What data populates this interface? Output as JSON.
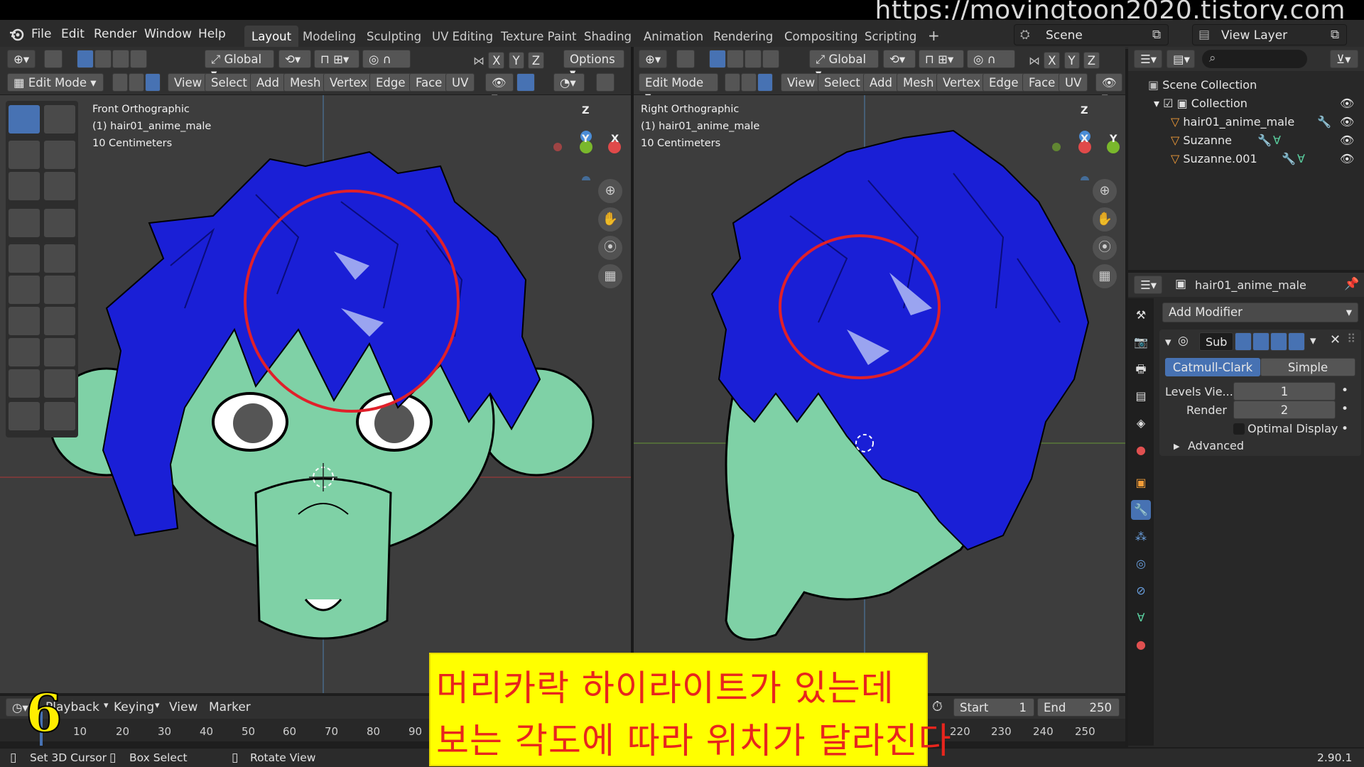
{
  "watermark": "https://movingtoon2020.tistory.com",
  "menu": [
    "File",
    "Edit",
    "Render",
    "Window",
    "Help"
  ],
  "workspaces": [
    "Layout",
    "Modeling",
    "Sculpting",
    "UV Editing",
    "Texture Paint",
    "Shading",
    "Animation",
    "Rendering",
    "Compositing",
    "Scripting"
  ],
  "active_workspace": "Layout",
  "add_tab": "+",
  "scene": {
    "label": "Scene",
    "view_layer": "View Layer"
  },
  "toolbar": {
    "orientation": "Global",
    "axes": [
      "X",
      "Y",
      "Z"
    ],
    "options": "Options",
    "mode": "Edit Mode",
    "menus": [
      "View",
      "Select",
      "Add",
      "Mesh",
      "Vertex",
      "Edge",
      "Face",
      "UV"
    ]
  },
  "viewport_left": {
    "view_name": "Front Orthographic",
    "object": "(1) hair01_anime_male",
    "scale": "10 Centimeters"
  },
  "viewport_right": {
    "view_name": "Right Orthographic",
    "object": "(1) hair01_anime_male",
    "scale": "10 Centimeters"
  },
  "gizmo": {
    "z": "Z",
    "y": "Y",
    "x": "X"
  },
  "outliner": {
    "root": "Scene Collection",
    "collection": "Collection",
    "items": [
      "hair01_anime_male",
      "Suzanne",
      "Suzanne.001"
    ]
  },
  "properties": {
    "object_name": "hair01_anime_male",
    "add_modifier": "Add Modifier",
    "modifier_name": "Sub",
    "subdiv_types": [
      "Catmull-Clark",
      "Simple"
    ],
    "levels_label": "Levels Vie...",
    "levels_value": "1",
    "render_label": "Render",
    "render_value": "2",
    "optimal_display": "Optimal Display",
    "advanced": "Advanced"
  },
  "timeline": {
    "frame_badge": "6",
    "playback": "Playback",
    "keying": "Keying",
    "view": "View",
    "marker": "Marker",
    "ticks_left": [
      "10",
      "20",
      "30",
      "40",
      "50",
      "60",
      "70",
      "80",
      "90"
    ],
    "ticks_right": [
      "220",
      "230",
      "240",
      "250"
    ],
    "start_label": "Start",
    "start_value": "1",
    "end_label": "End",
    "end_value": "250"
  },
  "statusbar": {
    "set_cursor": "Set 3D Cursor",
    "box_select": "Box Select",
    "rotate_view": "Rotate View",
    "version": "2.90.1"
  },
  "subtitle": {
    "line1": "머리카락 하이라이트가 있는데",
    "line2": "보는 각도에 따라 위치가 달라진다"
  },
  "colors": {
    "accent": "#4772b3",
    "hair": "#1a1fd6",
    "skin": "#7fd1a6",
    "highlight_circle": "#e0202a",
    "subtitle_bg": "#ffff00",
    "subtitle_text": "#e8251d"
  }
}
